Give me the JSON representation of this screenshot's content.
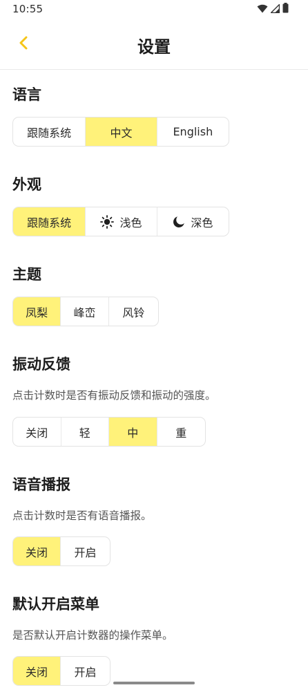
{
  "status_bar": {
    "time": "10:55",
    "icons": [
      "wifi-icon",
      "signal-icon",
      "battery-icon"
    ]
  },
  "header": {
    "back_icon": "chevron-left-icon",
    "title": "设置"
  },
  "colors": {
    "accent": "#f5c518",
    "selected_bg": "#fff27a"
  },
  "sections": {
    "language": {
      "title": "语言",
      "options": [
        "跟随系统",
        "中文",
        "English"
      ],
      "selected": "中文"
    },
    "appearance": {
      "title": "外观",
      "options": [
        "跟随系统",
        "浅色",
        "深色"
      ],
      "icons": [
        "",
        "sun-icon",
        "moon-icon"
      ],
      "selected": "跟随系统"
    },
    "theme": {
      "title": "主题",
      "options": [
        "凤梨",
        "峰峦",
        "风铃"
      ],
      "selected": "凤梨"
    },
    "haptics": {
      "title": "振动反馈",
      "description": "点击计数时是否有振动反馈和振动的强度。",
      "options": [
        "关闭",
        "轻",
        "中",
        "重"
      ],
      "selected": "中"
    },
    "voice": {
      "title": "语音播报",
      "description": "点击计数时是否有语音播报。",
      "options": [
        "关闭",
        "开启"
      ],
      "selected": "关闭"
    },
    "default_menu": {
      "title": "默认开启菜单",
      "description": "是否默认开启计数器的操作菜单。",
      "options": [
        "关闭",
        "开启"
      ],
      "selected": "关闭"
    }
  }
}
